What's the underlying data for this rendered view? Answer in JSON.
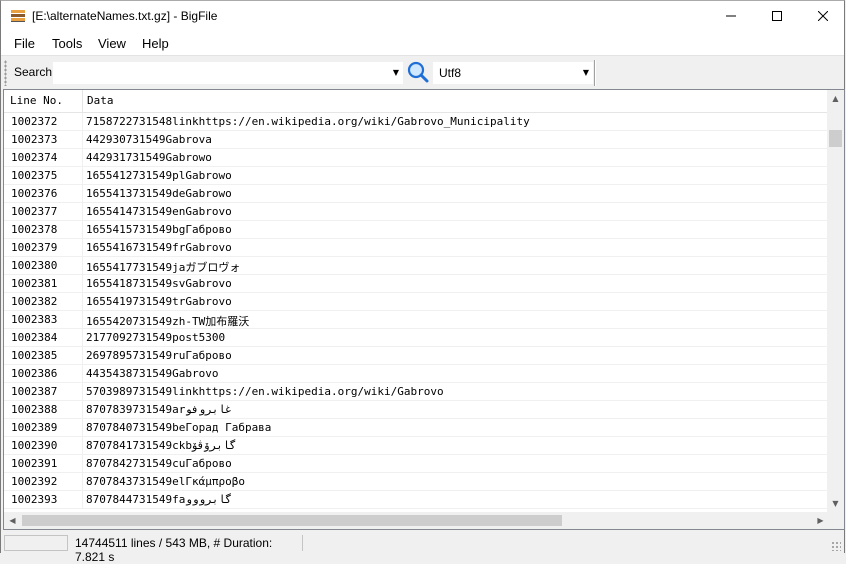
{
  "window": {
    "title": "[E:\\alternateNames.txt.gz] - BigFile",
    "minimize_icon": "minimize-icon",
    "maximize_icon": "maximize-icon",
    "close_icon": "close-icon"
  },
  "menu": {
    "items": [
      "File",
      "Tools",
      "View",
      "Help"
    ]
  },
  "toolbar": {
    "search_label": "Search",
    "search_value": "",
    "encoding_value": "Utf8"
  },
  "table": {
    "columns": [
      "Line No.",
      "Data"
    ],
    "rows": [
      {
        "line": "1002372",
        "data": "7158722731548linkhttps://en.wikipedia.org/wiki/Gabrovo_Municipality"
      },
      {
        "line": "1002373",
        "data": "442930731549Gabrova"
      },
      {
        "line": "1002374",
        "data": "442931731549Gabrowo"
      },
      {
        "line": "1002375",
        "data": "1655412731549plGabrowo"
      },
      {
        "line": "1002376",
        "data": "1655413731549deGabrowo"
      },
      {
        "line": "1002377",
        "data": "1655414731549enGabrovo"
      },
      {
        "line": "1002378",
        "data": "1655415731549bgГаброво"
      },
      {
        "line": "1002379",
        "data": "1655416731549frGabrovo"
      },
      {
        "line": "1002380",
        "data": "1655417731549jaガブロヴォ"
      },
      {
        "line": "1002381",
        "data": "1655418731549svGabrovo"
      },
      {
        "line": "1002382",
        "data": "1655419731549trGabrovo"
      },
      {
        "line": "1002383",
        "data": "1655420731549zh-TW加布羅沃"
      },
      {
        "line": "1002384",
        "data": "2177092731549post5300"
      },
      {
        "line": "1002385",
        "data": "2697895731549ruГаброво"
      },
      {
        "line": "1002386",
        "data": "4435438731549Gabrovo"
      },
      {
        "line": "1002387",
        "data": "5703989731549linkhttps://en.wikipedia.org/wiki/Gabrovo"
      },
      {
        "line": "1002388",
        "data": "8707839731549arغابروفو"
      },
      {
        "line": "1002389",
        "data": "8707840731549beГорад Габрава"
      },
      {
        "line": "1002390",
        "data": "8707841731549ckbگابرۆڤۆ"
      },
      {
        "line": "1002391",
        "data": "8707842731549cuГаброво"
      },
      {
        "line": "1002392",
        "data": "8707843731549elΓκάμπροβο"
      },
      {
        "line": "1002393",
        "data": "8707844731549faگابرووو"
      }
    ]
  },
  "statusbar": {
    "panel1": "",
    "info": "14744511 lines / 543 MB, # Duration: 7.821 s"
  }
}
